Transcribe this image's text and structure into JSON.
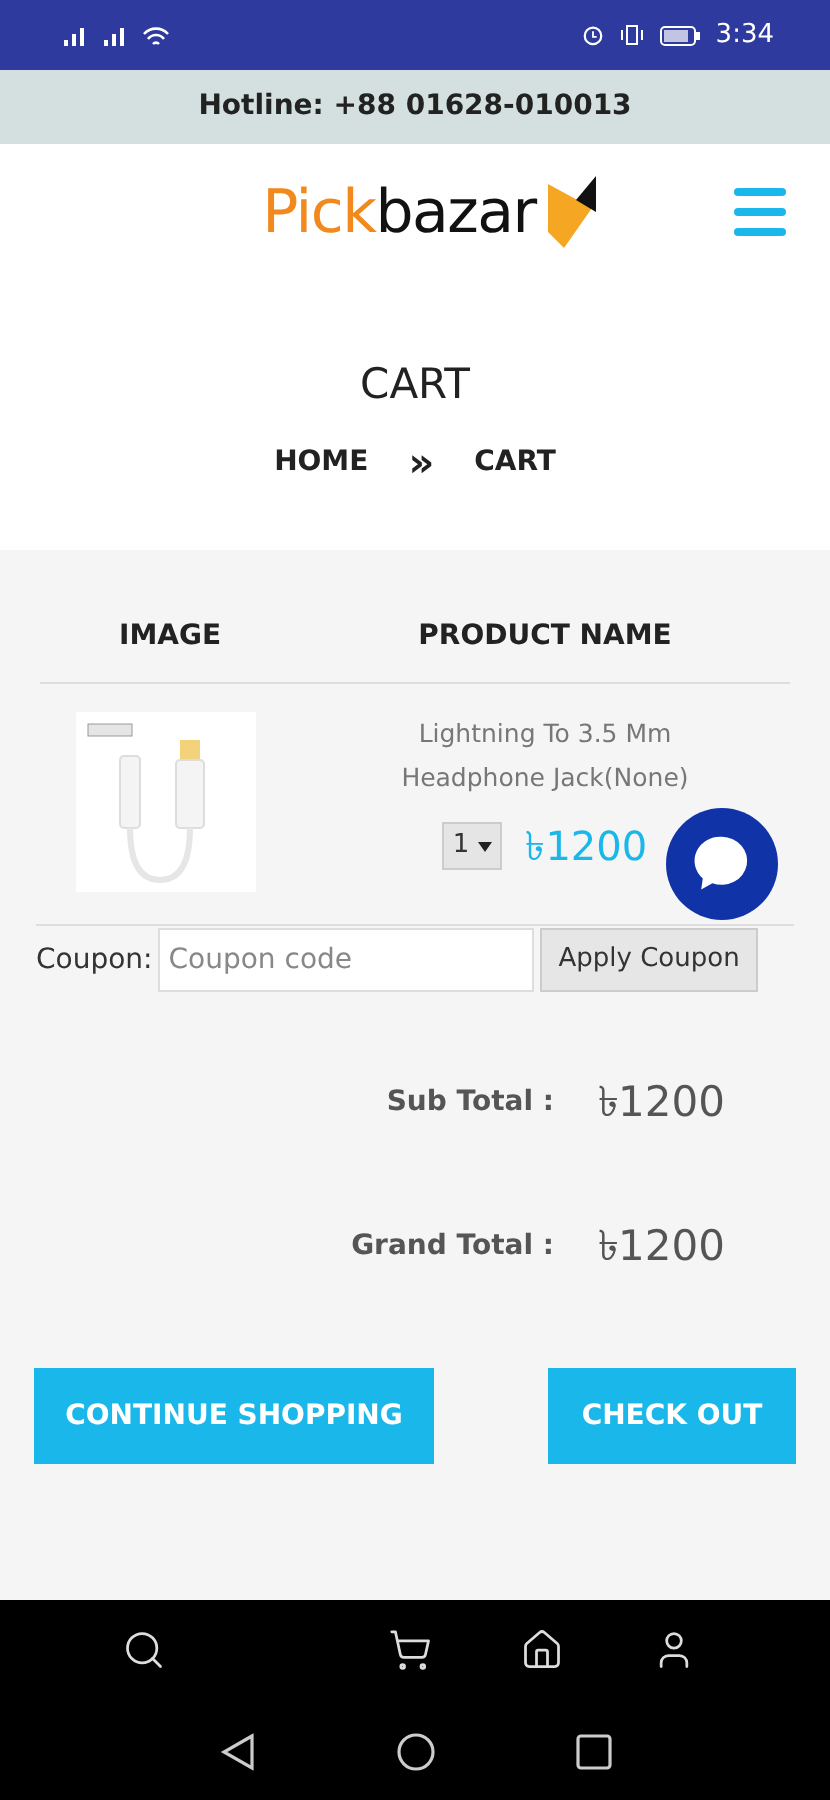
{
  "status_bar": {
    "time": "3:34"
  },
  "hotline": "Hotline: +88 01628-010013",
  "logo": {
    "part1": "Pick",
    "part2": "bazar"
  },
  "page_title": "CART",
  "breadcrumb": [
    {
      "label": "HOME"
    },
    {
      "label": "»"
    },
    {
      "label": "CART"
    }
  ],
  "table": {
    "columns": [
      "IMAGE",
      "PRODUCT NAME"
    ],
    "rows": [
      {
        "name": "Lightning To 3.5 Mm Headphone Jack(None)",
        "quantity": "1",
        "price": "৳1200"
      }
    ]
  },
  "coupon": {
    "label": "Coupon:",
    "placeholder": "Coupon code",
    "button": "Apply Coupon"
  },
  "totals": [
    {
      "label": "Sub Total :",
      "value": "৳1200"
    },
    {
      "label": "Grand Total :",
      "value": "৳1200"
    }
  ],
  "buttons": [
    "CONTINUE SHOPPING",
    "CHECK OUT"
  ],
  "bottom_nav": [
    {
      "kind": "search"
    },
    {
      "kind": "cart"
    },
    {
      "kind": "home"
    },
    {
      "kind": "user"
    }
  ]
}
